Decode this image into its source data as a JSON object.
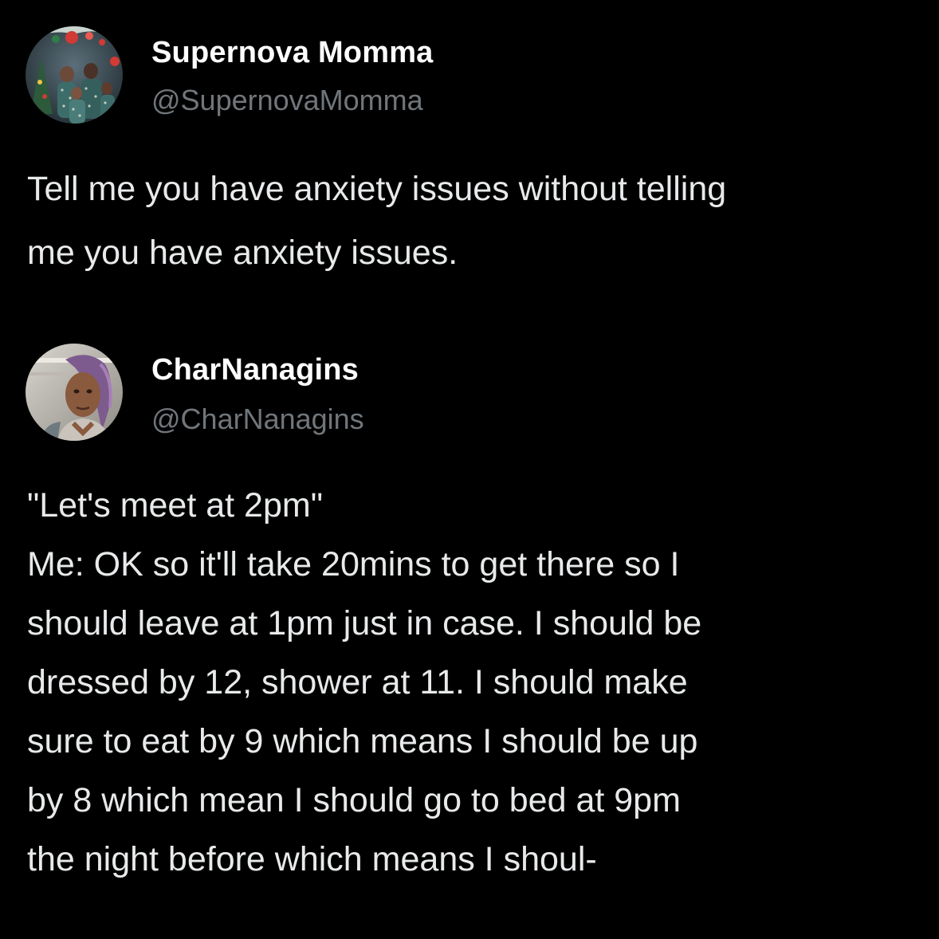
{
  "tweets": [
    {
      "display_name": "Supernova Momma",
      "handle": "@SupernovaMomma",
      "avatar_icon": "family-christmas-photo-avatar",
      "text": "Tell me you have anxiety issues without telling\nme you have anxiety issues."
    },
    {
      "display_name": "CharNanagins",
      "handle": "@CharNanagins",
      "avatar_icon": "selfie-avatar",
      "text": "\"Let's meet at 2pm\"\nMe: OK so it'll take 20mins to get there so I\nshould leave at 1pm just in case. I should be\ndressed by 12, shower at 11. I should make\nsure to eat by 9 which means I should be up\nby 8 which mean I should go to bed at 9pm\nthe night before which means I shoul-"
    }
  ],
  "colors": {
    "background": "#000000",
    "name": "#ffffff",
    "handle": "#71767b",
    "text": "#e7e9ea"
  }
}
